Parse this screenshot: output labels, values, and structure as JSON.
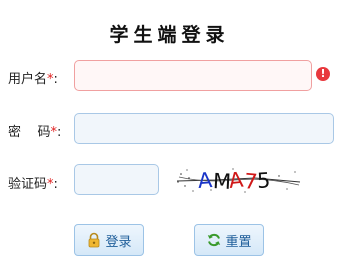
{
  "title": "学生端登录",
  "form": {
    "username": {
      "label": "用户名",
      "required_mark": "*",
      "colon": ":",
      "value": "",
      "placeholder": "",
      "has_error": true
    },
    "password": {
      "label": "密    码",
      "required_mark": "*",
      "colon": ":",
      "value": "",
      "placeholder": ""
    },
    "captcha": {
      "label": "验证码",
      "required_mark": "*",
      "colon": ":",
      "value": "",
      "placeholder": "",
      "image_text": [
        "A",
        "M",
        "A",
        "7",
        "5"
      ],
      "image_colors": [
        "#1a35c8",
        "#111111",
        "#d01818",
        "#d01818",
        "#111111"
      ]
    }
  },
  "buttons": {
    "login": {
      "label": "登录",
      "icon": "lock-icon"
    },
    "reset": {
      "label": "重置",
      "icon": "refresh-icon"
    }
  },
  "colors": {
    "required": "#e02020",
    "error_icon": "#e8383d",
    "button_text": "#1f5e9a"
  }
}
